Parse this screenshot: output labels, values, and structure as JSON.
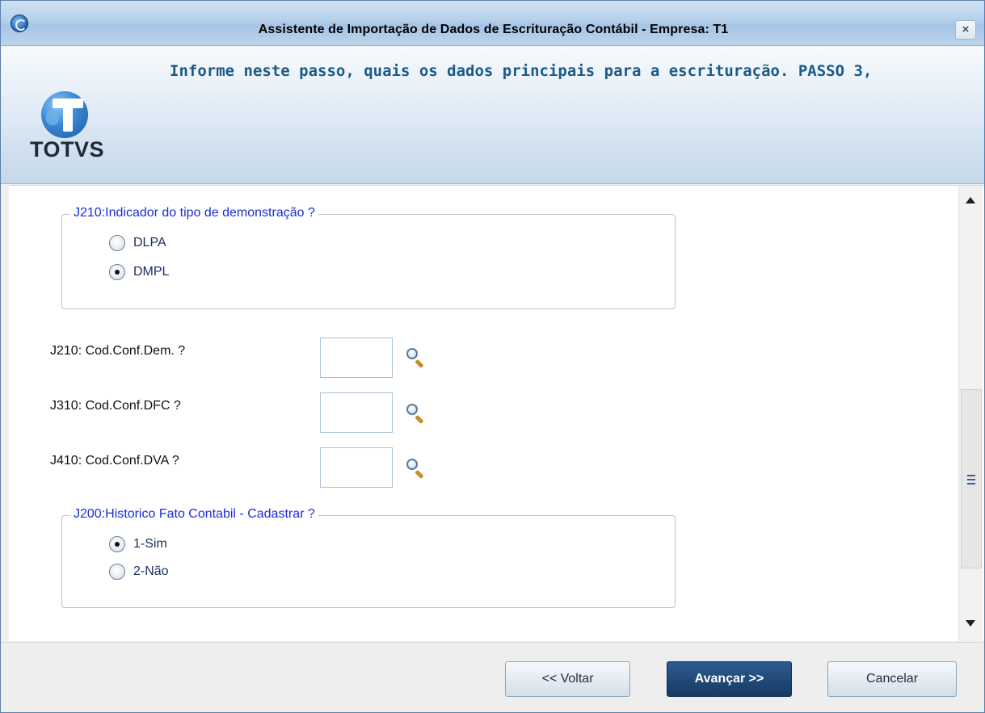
{
  "window": {
    "title": "Assistente de Importação de Dados de Escrituração Contábil - Empresa: T1",
    "close_glyph": "×"
  },
  "header": {
    "logo_text": "TOTVS",
    "step_text": "Informe neste passo, quais os dados principais para a escrituração. PASSO 3,"
  },
  "form": {
    "group_demonstracao": {
      "legend": "J210:Indicador do tipo de demonstração ?",
      "options": [
        {
          "label": "DLPA",
          "checked": false
        },
        {
          "label": "DMPL",
          "checked": true
        }
      ]
    },
    "fields": [
      {
        "label": "J210: Cod.Conf.Dem.  ?",
        "value": ""
      },
      {
        "label": "J310: Cod.Conf.DFC ?",
        "value": ""
      },
      {
        "label": "J410: Cod.Conf.DVA ?",
        "value": ""
      }
    ],
    "group_historico": {
      "legend": "J200:Historico Fato Contabil - Cadastrar ?",
      "options": [
        {
          "label": "1-Sim",
          "checked": true
        },
        {
          "label": "2-Não",
          "checked": false
        }
      ]
    }
  },
  "footer": {
    "back_label": "<< Voltar",
    "next_label": "Avançar >>",
    "cancel_label": "Cancelar"
  },
  "colors": {
    "legend": "#1a2dd6",
    "step_text": "#1d5a86",
    "primary_button": "#173a63"
  },
  "icons": {
    "title": "app-icon",
    "lookup": "magnifier-icon"
  }
}
